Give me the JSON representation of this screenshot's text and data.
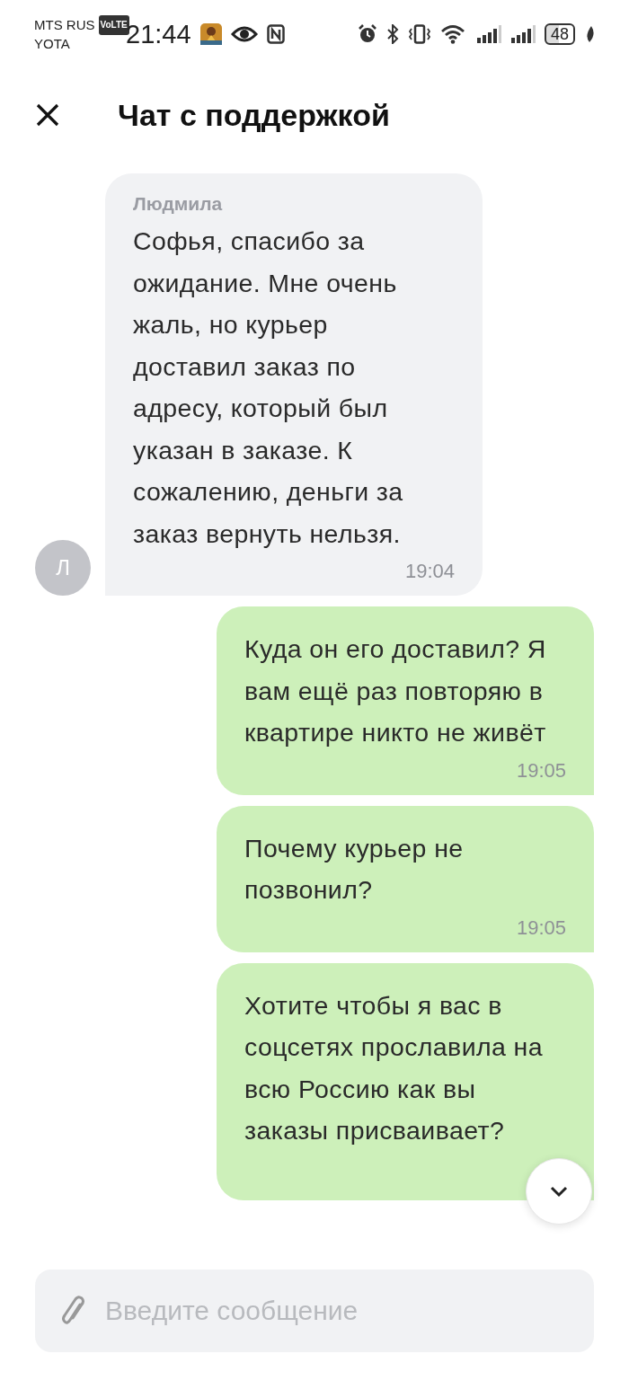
{
  "status_bar": {
    "carrier_1": "MTS RUS",
    "volte": "VoLTE",
    "carrier_2": "YOTA",
    "time": "21:44",
    "battery": "48"
  },
  "header": {
    "title": "Чат с поддержкой"
  },
  "messages": [
    {
      "kind": "incoming",
      "author": "Людмила",
      "avatar": "Л",
      "text": "Софья, спасибо за ожидание. Мне очень жаль, но курьер доставил заказ по адресу, который был указан в заказе. К сожалению, деньги за заказ вернуть нельзя.",
      "time": "19:04"
    },
    {
      "kind": "outgoing",
      "text": "Куда он его доставил? Я вам ещё раз повторяю в квартире никто не живёт",
      "time": "19:05"
    },
    {
      "kind": "outgoing",
      "text": "Почему курьер не позвонил?",
      "time": "19:05"
    },
    {
      "kind": "outgoing",
      "text": "Хотите чтобы я вас в соцсетях прославила на всю Россию как вы заказы присваивает?"
    }
  ],
  "composer": {
    "placeholder": "Введите сообщение"
  }
}
